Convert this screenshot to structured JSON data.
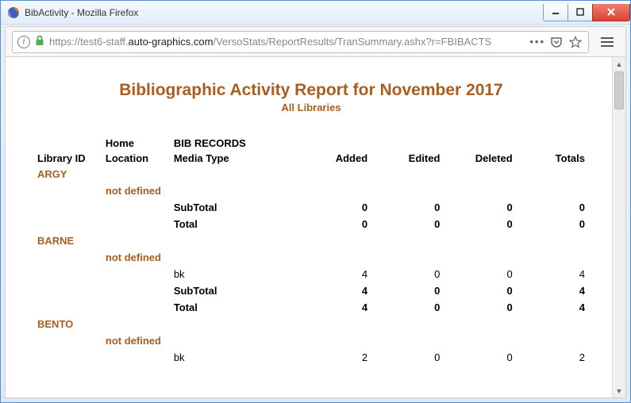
{
  "window": {
    "title": "BibActivity - Mozilla Firefox",
    "min_tip": "Minimize",
    "max_tip": "Maximize",
    "close_tip": "Close"
  },
  "url": {
    "scheme": "https://",
    "host_light_pre": "test6-staff.",
    "host_dark": "auto-graphics.com",
    "path": "/VersoStats/ReportResults/TranSummary.ashx?r=FBIBACTS"
  },
  "report": {
    "title": "Bibliographic Activity Report for November 2017",
    "subtitle": "All Libraries",
    "headers": {
      "library_id": "Library ID",
      "home_loc_l1": "Home",
      "home_loc_l2": "Location",
      "bib_header": "BIB RECORDS",
      "media_type": "Media Type",
      "added": "Added",
      "edited": "Edited",
      "deleted": "Deleted",
      "totals": "Totals"
    },
    "labels": {
      "not_defined": "not defined",
      "subtotal": "SubTotal",
      "total": "Total"
    },
    "groups": [
      {
        "library_id": "ARGY",
        "rows": [],
        "subtotal": {
          "added": "0",
          "edited": "0",
          "deleted": "0",
          "totals": "0"
        },
        "total": {
          "added": "0",
          "edited": "0",
          "deleted": "0",
          "totals": "0"
        }
      },
      {
        "library_id": "BARNE",
        "rows": [
          {
            "media": "bk",
            "added": "4",
            "edited": "0",
            "deleted": "0",
            "totals": "4"
          }
        ],
        "subtotal": {
          "added": "4",
          "edited": "0",
          "deleted": "0",
          "totals": "4"
        },
        "total": {
          "added": "4",
          "edited": "0",
          "deleted": "0",
          "totals": "4"
        }
      },
      {
        "library_id": "BENTO",
        "rows": [
          {
            "media": "bk",
            "added": "2",
            "edited": "0",
            "deleted": "0",
            "totals": "2"
          }
        ]
      }
    ]
  }
}
